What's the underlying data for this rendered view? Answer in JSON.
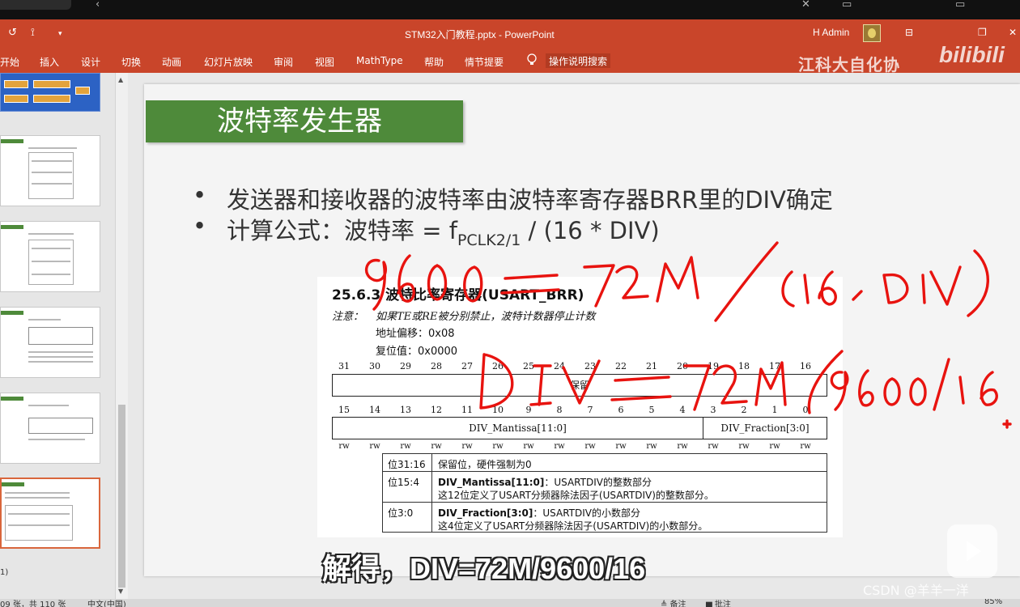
{
  "app": {
    "doc_title": "STM32入门教程.pptx  -  PowerPoint",
    "user": "H Admin",
    "brand_text": "江科大自化协",
    "bili_text": "bilibili"
  },
  "quick_access": {
    "undo": "↺",
    "preview": "⟟",
    "more": "▾"
  },
  "window_buttons": {
    "share": "⌧",
    "ribbon_display": "⊟",
    "restore": "❐",
    "close": "✕"
  },
  "ribbon": {
    "tabs": [
      "开始",
      "插入",
      "设计",
      "切换",
      "动画",
      "幻灯片放映",
      "审阅",
      "视图",
      "MathType",
      "帮助",
      "情节提要"
    ],
    "search_label": "操作说明搜索"
  },
  "slide": {
    "title": "波特率发生器",
    "bullet_char": "•",
    "bullet1": "发送器和接收器的波特率由波特率寄存器BRR里的DIV确定",
    "bullet2_pre": "计算公式：波特率 = f",
    "bullet2_sub": "PCLK2/1",
    "bullet2_post": " / (16 * DIV)"
  },
  "register": {
    "heading": "25.6.3   波特比率寄存器(USART_BRR)",
    "note_label": "注意：",
    "note_text": "如果TE或RE被分别禁止，波特计数器停止计数",
    "offset": "地址偏移：0x08",
    "reset": "复位值：0x0000",
    "bits_high": [
      "31",
      "30",
      "29",
      "28",
      "27",
      "26",
      "25",
      "24",
      "23",
      "22",
      "21",
      "20",
      "19",
      "18",
      "17",
      "16"
    ],
    "bits_low": [
      "15",
      "14",
      "13",
      "12",
      "11",
      "10",
      "9",
      "8",
      "7",
      "6",
      "5",
      "4",
      "3",
      "2",
      "1",
      "0"
    ],
    "reserved": "保留",
    "mantissa": "DIV_Mantissa[11:0]",
    "fraction": "DIV_Fraction[3:0]",
    "rw": "rw",
    "rows": [
      {
        "bits": "位31:16",
        "name": "",
        "desc": "保留位，硬件强制为0",
        "desc2": ""
      },
      {
        "bits": "位15:4",
        "name": "DIV_Mantissa[11:0]",
        "desc": "：USARTDIV的整数部分",
        "desc2": "这12位定义了USART分频器除法因子(USARTDIV)的整数部分。"
      },
      {
        "bits": "位3:0",
        "name": "DIV_Fraction[3:0]",
        "desc": "：USARTDIV的小数部分",
        "desc2": "这4位定义了USART分频器除法因子(USARTDIV)的小数部分。"
      }
    ]
  },
  "subtitle": "解得，DIV=72M/9600/16",
  "watermark": "CSDN @羊羊一洋",
  "thumb_tag": "1)",
  "status": {
    "slide_count": "09 张，共 110 张",
    "lang": "中文(中国)",
    "notes": "≜ 备注",
    "comments": "▆ 批注",
    "zoom": "85%"
  }
}
